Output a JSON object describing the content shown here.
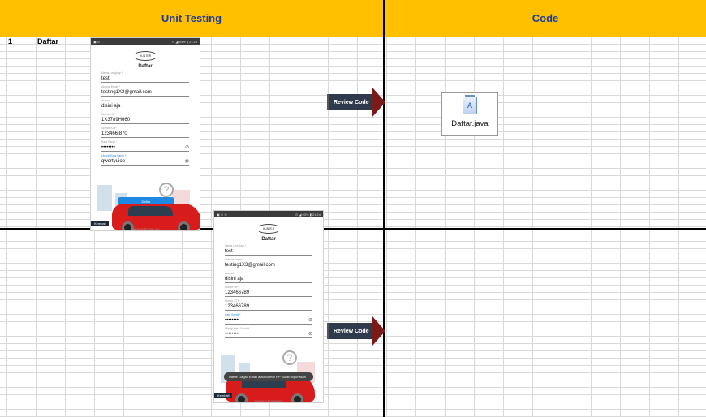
{
  "header": {
    "left_title": "Unit Testing",
    "right_title": "Code"
  },
  "row": {
    "number": "1",
    "label": "Daftar"
  },
  "arrow_label": "Review Code",
  "file": {
    "name": "Daftar.java",
    "icon": "document-icon"
  },
  "phone1": {
    "logo": "HUNTER",
    "title": "Daftar",
    "fields": [
      {
        "label": "Nama Lengkap *",
        "value": "test"
      },
      {
        "label": "Alamat Email *",
        "value": "testing1X3@gmail.com"
      },
      {
        "label": "Alamat",
        "value": "disini aja"
      },
      {
        "label": "Nomor HP *",
        "value": "1X3789H660"
      },
      {
        "label": "Nomor KTP",
        "value": "123466I870"
      },
      {
        "label": "Kata Sandi *",
        "value": "••••••••"
      },
      {
        "label": "Ulangi Kata Sandi *",
        "value": "qwertyuiop"
      }
    ],
    "button": "Daftar",
    "back": "Kembali",
    "footer": "powered by @ hunter.com"
  },
  "phone2": {
    "logo": "HUNTER",
    "title": "Daftar",
    "fields": [
      {
        "label": "Nama Lengkap *",
        "value": "test"
      },
      {
        "label": "Alamat Email *",
        "value": "testing1X3@gmail.com"
      },
      {
        "label": "Alamat",
        "value": "disini aja"
      },
      {
        "label": "Nomor HP *",
        "value": "123466789"
      },
      {
        "label": "Nomor KTP",
        "value": "123466789"
      },
      {
        "label": "Kata Sandi *",
        "value": "••••••••"
      },
      {
        "label": "Ulangi Kata Sandi *",
        "value": "••••••••"
      }
    ],
    "toast": "Daftar Gagal, Email atau Nomor HP sudah digunakan",
    "back": "Kembali",
    "footer": "powered by @ hunter.com"
  }
}
